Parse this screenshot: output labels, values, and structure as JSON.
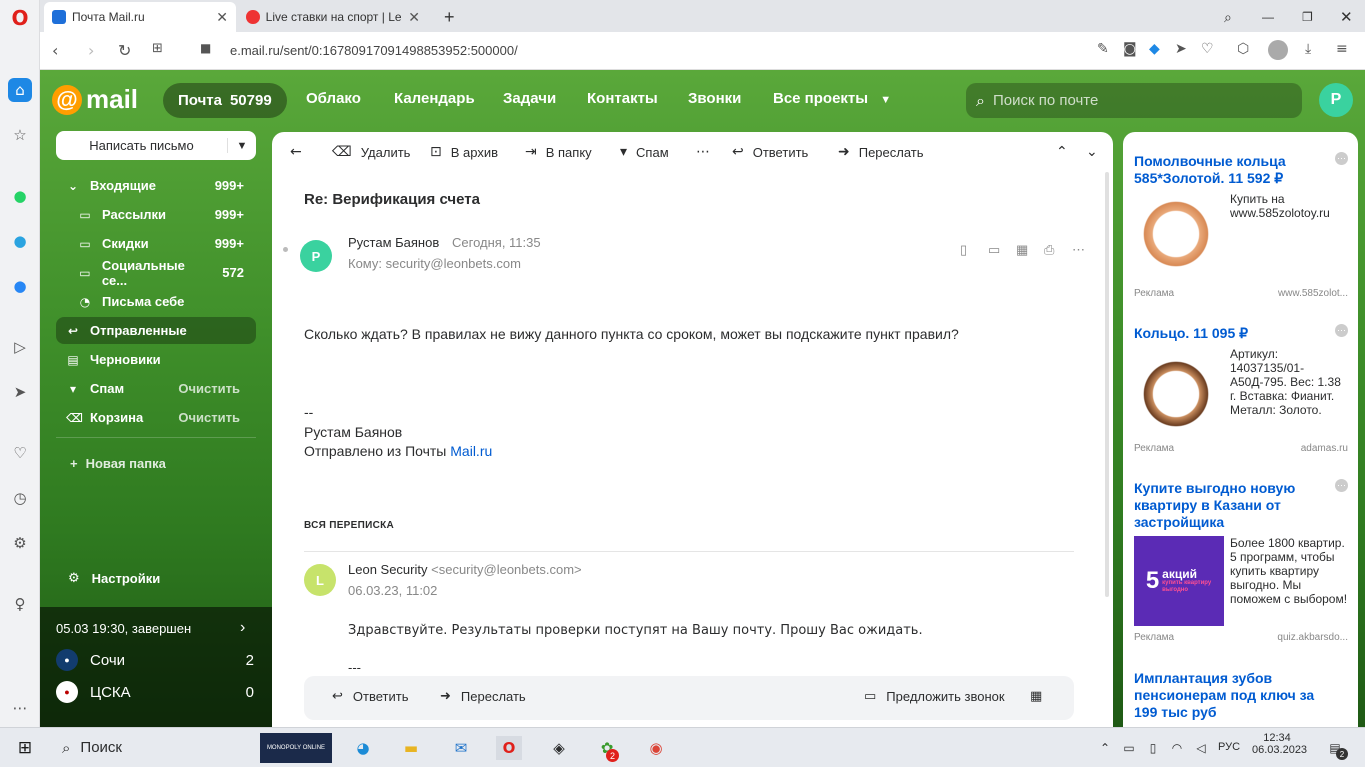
{
  "browser": {
    "tabs": [
      {
        "title": "Почта Mail.ru"
      },
      {
        "title": "Live ставки на спорт | Leo"
      }
    ],
    "url": "e.mail.ru/sent/0:16780917091498853952:500000/",
    "new_tab": "+"
  },
  "header": {
    "logo": "mail",
    "mail_label": "Почта",
    "mail_count": "50799",
    "nav": [
      "Облако",
      "Календарь",
      "Задачи",
      "Контакты",
      "Звонки",
      "Все проекты"
    ],
    "search_placeholder": "Поиск по почте",
    "avatar_letter": "Р"
  },
  "sidebar": {
    "compose": "Написать письмо",
    "folders": [
      {
        "label": "Входящие",
        "count": "999+"
      },
      {
        "label": "Рассылки",
        "count": "999+"
      },
      {
        "label": "Скидки",
        "count": "999+"
      },
      {
        "label": "Социальные се...",
        "count": "572"
      },
      {
        "label": "Письма себе",
        "count": ""
      },
      {
        "label": "Отправленные",
        "count": ""
      },
      {
        "label": "Черновики",
        "count": ""
      },
      {
        "label": "Спам",
        "action": "Очистить"
      },
      {
        "label": "Корзина",
        "action": "Очистить"
      }
    ],
    "new_folder": "Новая папка",
    "settings": "Настройки",
    "match": {
      "status": "05.03 19:30, завершен",
      "team1": "Сочи",
      "score1": "2",
      "team2": "ЦСКА",
      "score2": "0"
    }
  },
  "toolbar": {
    "delete": "Удалить",
    "archive": "В архив",
    "folder": "В папку",
    "spam": "Спам",
    "reply": "Ответить",
    "forward": "Переслать"
  },
  "message": {
    "subject": "Re: Верификация счета",
    "sender": "Рустам Баянов",
    "sender_initial": "Р",
    "time": "Сегодня, 11:35",
    "to": "Кому: security@leonbets.com",
    "body": "Сколько ждать? В правилах не вижу данного пункта со сроком, может вы подскажите пункт правил?",
    "sig_dash": "--",
    "sig_name": "Рустам Баянов",
    "sig_sent": "Отправлено из Почты ",
    "sig_link": "Mail.ru"
  },
  "thread": {
    "header": "ВСЯ ПЕРЕПИСКА",
    "sender": "Leon Security",
    "sender_email": "<security@leonbets.com>",
    "sender_initial": "L",
    "date": "06.03.23, 11:02",
    "body": "Здравствуйте. Результаты проверки поступят на Вашу почту. Прошу Вас ожидать.",
    "dash": "---"
  },
  "quick_actions": {
    "reply": "Ответить",
    "forward": "Переслать",
    "call": "Предложить звонок"
  },
  "ads": [
    {
      "title": "Помолвочные кольца 585*Золотой. 11 592 ₽",
      "text": "Купить на www.585zolotoy.ru",
      "label": "Реклама",
      "domain": "www.585zolot..."
    },
    {
      "title": "Кольцо. 11 095 ₽",
      "text": "Артикул: 14037135/01-А50Д-795. Вес: 1.38 г. Вставка: Фианит. Металл: Золото.",
      "label": "Реклама",
      "domain": "adamas.ru"
    },
    {
      "title": "Купите выгодно новую квартиру в Казани от застройщика",
      "text": "Более 1800 квартир. 5 программ, чтобы купить квартиру выгодно. Мы поможем с выбором!",
      "label": "Реклама",
      "domain": "quiz.akbarsdo...",
      "banner_big": "5",
      "banner_top": "акций",
      "banner_sub": "купить квартиру выгодно"
    },
    {
      "title": "Имплантация зубов пенсионерам под ключ за 199 тыс руб"
    }
  ],
  "taskbar": {
    "search": "Поиск",
    "lang": "РУС",
    "time": "12:34",
    "date": "06.03.2023",
    "notif": "2",
    "app_badge": "2",
    "monopoly": "MONOPOLY ONLINE"
  },
  "colors": {
    "accent": "#005bd1",
    "green": "#3f8f2a",
    "avatar": "#3ad29f"
  }
}
